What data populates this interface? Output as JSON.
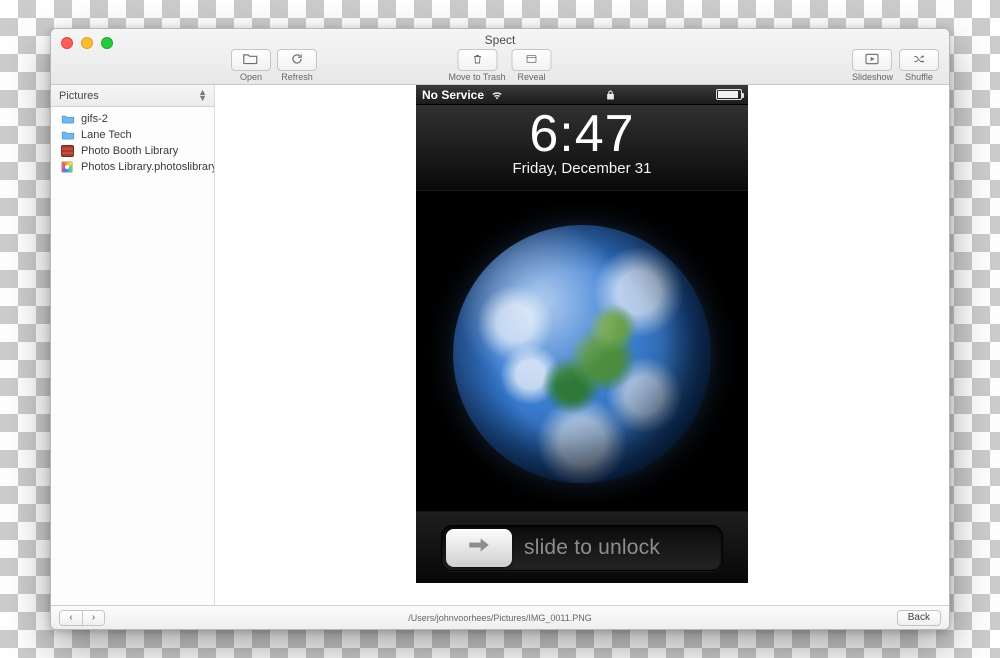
{
  "window": {
    "title": "Spect"
  },
  "toolbar": {
    "open": {
      "label": "Open",
      "icon_name": "open-folder-icon"
    },
    "refresh": {
      "label": "Refresh",
      "icon_name": "refresh-icon"
    },
    "trash": {
      "label": "Move to Trash",
      "icon_name": "trash-icon"
    },
    "reveal": {
      "label": "Reveal",
      "icon_name": "reveal-icon"
    },
    "slideshow": {
      "label": "Slideshow",
      "icon_name": "slideshow-icon"
    },
    "shuffle": {
      "label": "Shuffle",
      "icon_name": "shuffle-icon"
    }
  },
  "sidebar": {
    "header": "Pictures",
    "items": [
      {
        "label": "gifs-2",
        "icon": "folder"
      },
      {
        "label": "Lane Tech",
        "icon": "folder"
      },
      {
        "label": "Photo Booth Library",
        "icon": "photobooth"
      },
      {
        "label": "Photos Library.photoslibrary",
        "icon": "photos"
      }
    ]
  },
  "phone": {
    "status": {
      "carrier": "No Service"
    },
    "time": "6:47",
    "date": "Friday, December 31",
    "slide_text": "slide to unlock"
  },
  "footer": {
    "path": "/Users/johnvoorhees/Pictures/IMG_0011.PNG",
    "back": "Back"
  }
}
